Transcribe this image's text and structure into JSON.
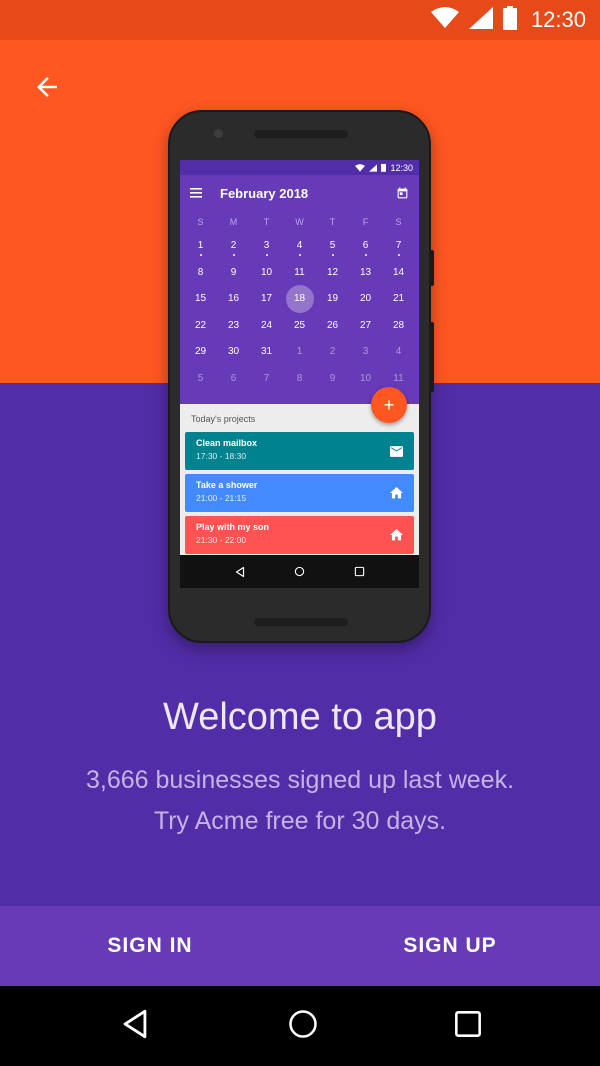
{
  "status_bar": {
    "time": "12:30"
  },
  "phone": {
    "status_time": "12:30",
    "calendar": {
      "month_title": "February  2018",
      "weekdays": [
        "S",
        "M",
        "T",
        "W",
        "T",
        "F",
        "S"
      ],
      "weeks": [
        [
          "1",
          "2",
          "3",
          "4",
          "5",
          "6",
          "7"
        ],
        [
          "8",
          "9",
          "10",
          "11",
          "12",
          "13",
          "14"
        ],
        [
          "15",
          "16",
          "17",
          "18",
          "19",
          "20",
          "21"
        ],
        [
          "22",
          "23",
          "24",
          "25",
          "26",
          "27",
          "28"
        ],
        [
          "29",
          "30",
          "31",
          "1",
          "2",
          "3",
          "4"
        ],
        [
          "5",
          "6",
          "7",
          "8",
          "9",
          "10",
          "11"
        ]
      ],
      "selected_day": "18"
    },
    "fab_label": "+",
    "projects_title": "Today's projects",
    "projects": [
      {
        "name": "Clean mailbox",
        "time": "17:30 - 18:30",
        "color": "#00838F",
        "icon": "mail-icon"
      },
      {
        "name": "Take a shower",
        "time": "21:00 - 21:15",
        "color": "#448AFF",
        "icon": "home-icon"
      },
      {
        "name": "Play with my son",
        "time": "21:30 - 22:00",
        "color": "#FF5252",
        "icon": "home-icon"
      }
    ]
  },
  "welcome": {
    "headline": "Welcome to app",
    "line1": "3,666 businesses signed up last week.",
    "line2": "Try Acme free for 30 days."
  },
  "actions": {
    "sign_in": "SIGN IN",
    "sign_up": "SIGN UP"
  },
  "colors": {
    "orange": "#FF5722",
    "orange_dark": "#E64A19",
    "purple": "#512DA8",
    "purple_light": "#673AB7"
  }
}
